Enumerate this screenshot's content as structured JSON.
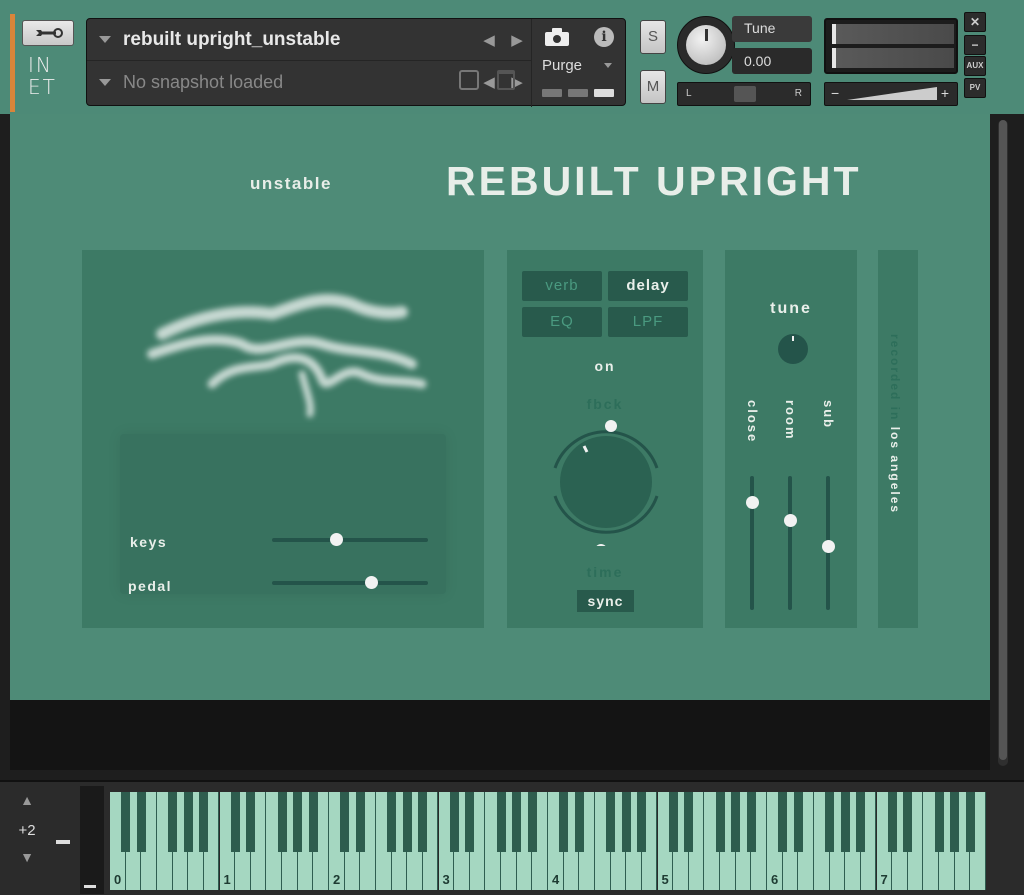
{
  "header": {
    "instrument_name": "rebuilt upright_unstable",
    "snapshot": "No snapshot loaded",
    "purge_label": "Purge",
    "info_glyph": "i",
    "solo_label": "S",
    "mute_label": "M",
    "tune_label": "Tune",
    "tune_value": "0.00",
    "pan_left": "L",
    "pan_right": "R",
    "vol_minus": "−",
    "vol_plus": "+",
    "close_glyph": "✕",
    "min_glyph": "−",
    "aux_label": "AUX",
    "pv_label": "PV",
    "logo_line1": "IN",
    "logo_line2": "ET"
  },
  "main": {
    "subtitle": "unstable",
    "title": "REBUILT UPRIGHT",
    "left_panel": {
      "sliders": [
        {
          "label": "keys",
          "value": 0.4
        },
        {
          "label": "pedal",
          "value": 0.63
        }
      ]
    },
    "fx_panel": {
      "buttons": [
        {
          "label": "verb",
          "active": false
        },
        {
          "label": "delay",
          "active": true
        },
        {
          "label": "EQ",
          "active": false
        },
        {
          "label": "LPF",
          "active": false
        }
      ],
      "on_label": "on",
      "fbck_label": "fbck",
      "time_label": "time",
      "sync_label": "sync"
    },
    "tune_panel": {
      "title": "tune",
      "faders": [
        {
          "label": "close",
          "value": 0.8
        },
        {
          "label": "room",
          "value": 0.6
        },
        {
          "label": "sub",
          "value": 0.4
        }
      ]
    },
    "recorded": {
      "prefix": "recorded in",
      "place": "los angeles"
    }
  },
  "keyboard": {
    "octave_shift": "+2",
    "octave_labels": [
      "0",
      "1",
      "2",
      "3",
      "4",
      "5",
      "6",
      "7"
    ]
  },
  "colors": {
    "panel_bg": "#4e8b77",
    "section_bg": "#3d7a65",
    "accent_dark": "#285a4c",
    "text_light": "#e9efea",
    "key_white": "#a5d7c1",
    "orange": "#d9853a"
  }
}
